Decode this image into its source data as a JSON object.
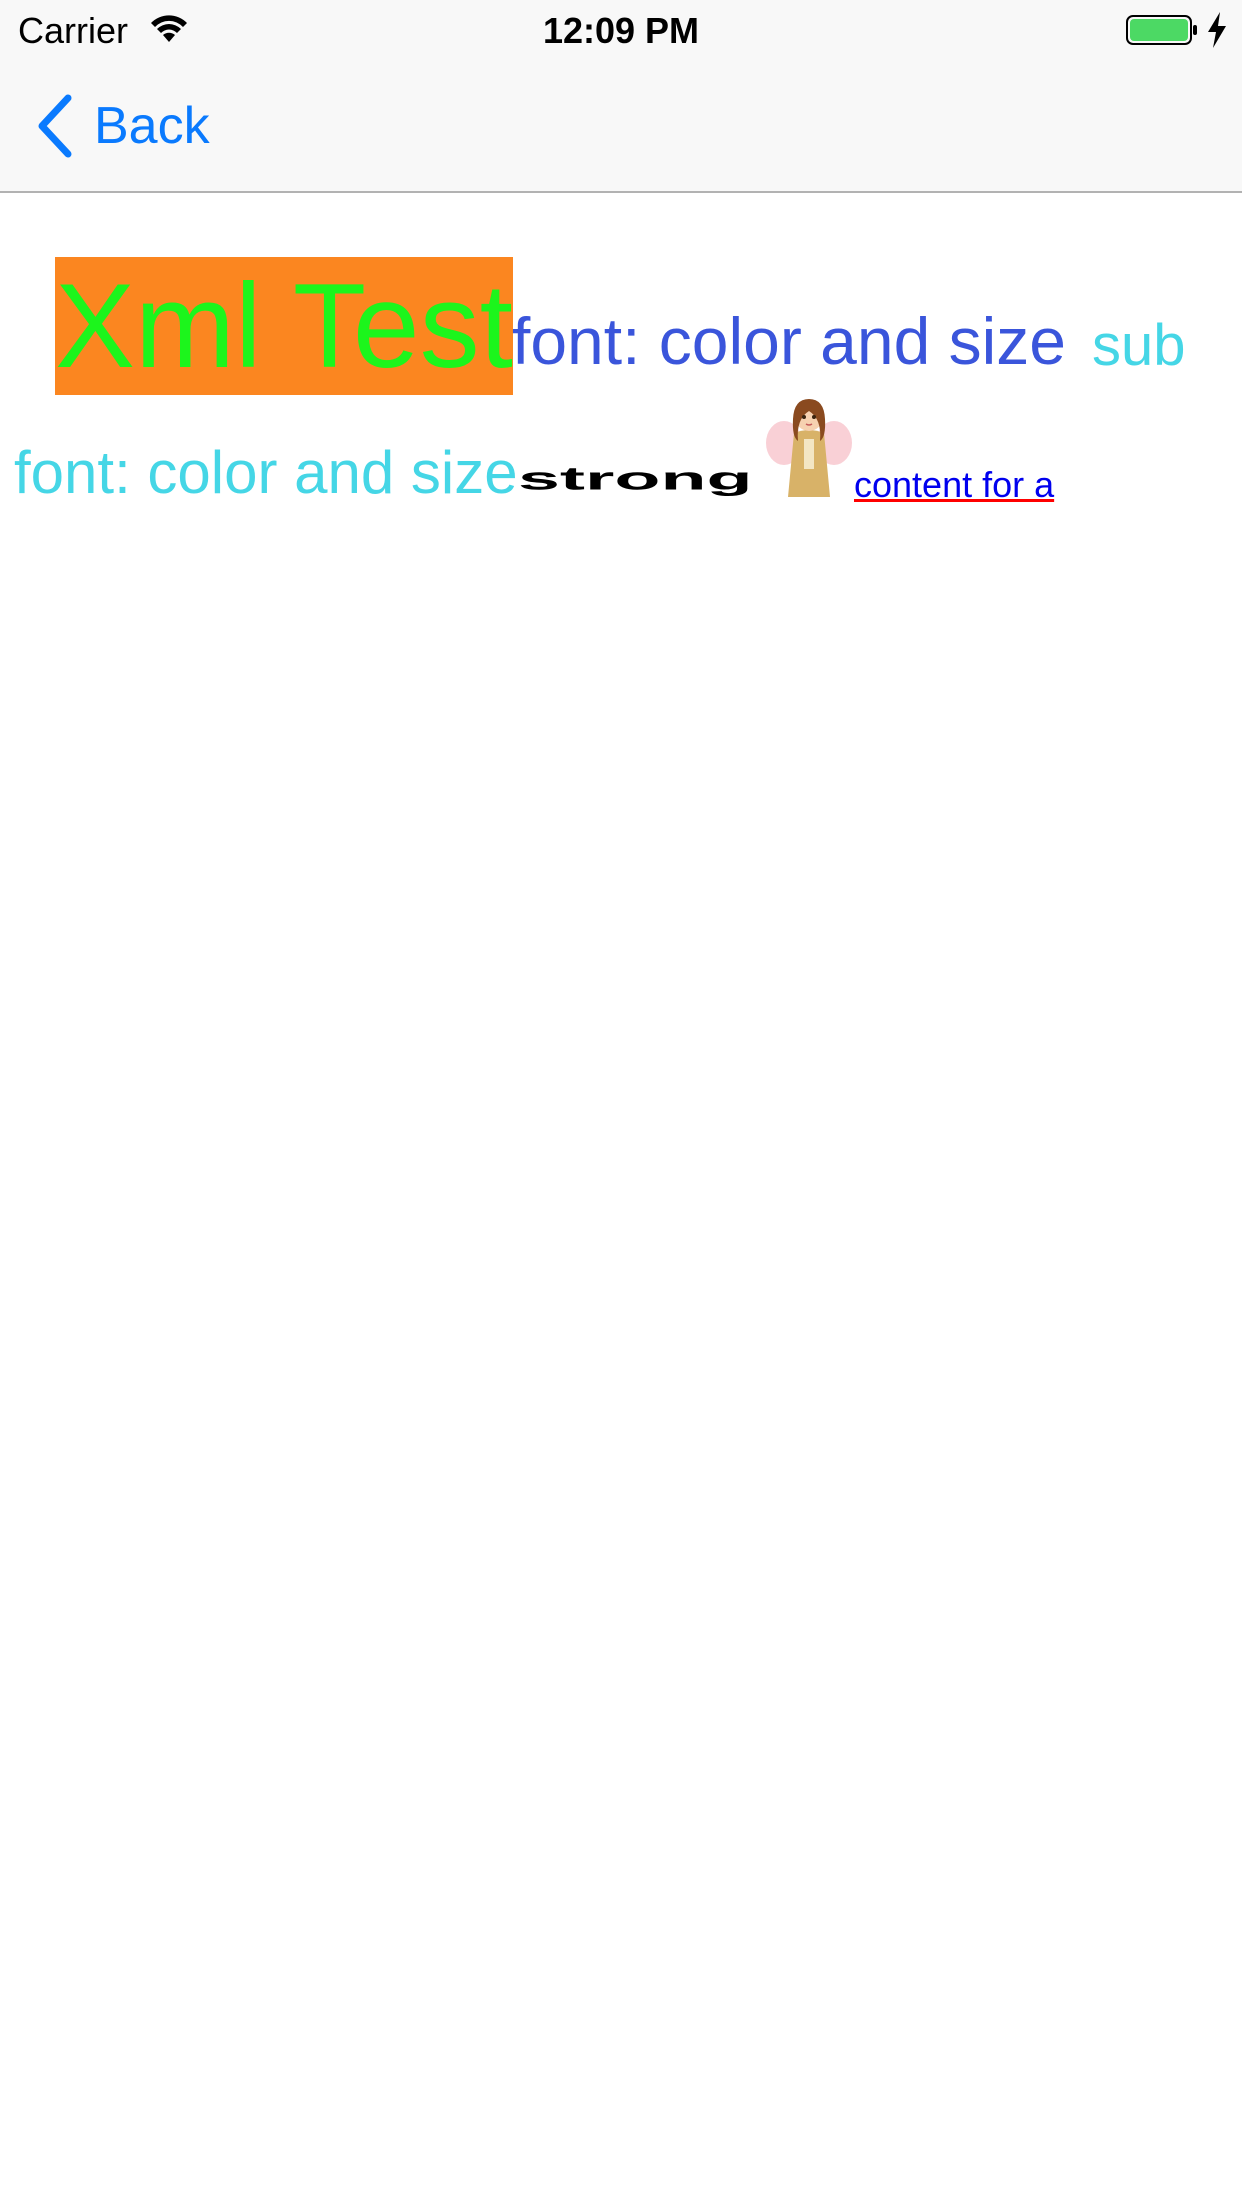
{
  "status_bar": {
    "carrier": "Carrier",
    "time": "12:09 PM",
    "battery_color": "#4cd964"
  },
  "nav_bar": {
    "back_label": "Back",
    "accent_color": "#0a7afe"
  },
  "content": {
    "title": "Xml Test",
    "title_color": "#1cf51c",
    "title_background": "#fb8620",
    "font_text_blue": "font: color and size",
    "font_text_blue_color": "#3a55db",
    "sub_text": "sub",
    "font_text_cyan": "font: color and size",
    "cyan_color": "#45d6e6",
    "strong_text": "strong",
    "image_icon": "angel-girl-image",
    "link_text": "content for a",
    "link_color": "#0000ee",
    "link_underline_color": "#ff0000"
  }
}
